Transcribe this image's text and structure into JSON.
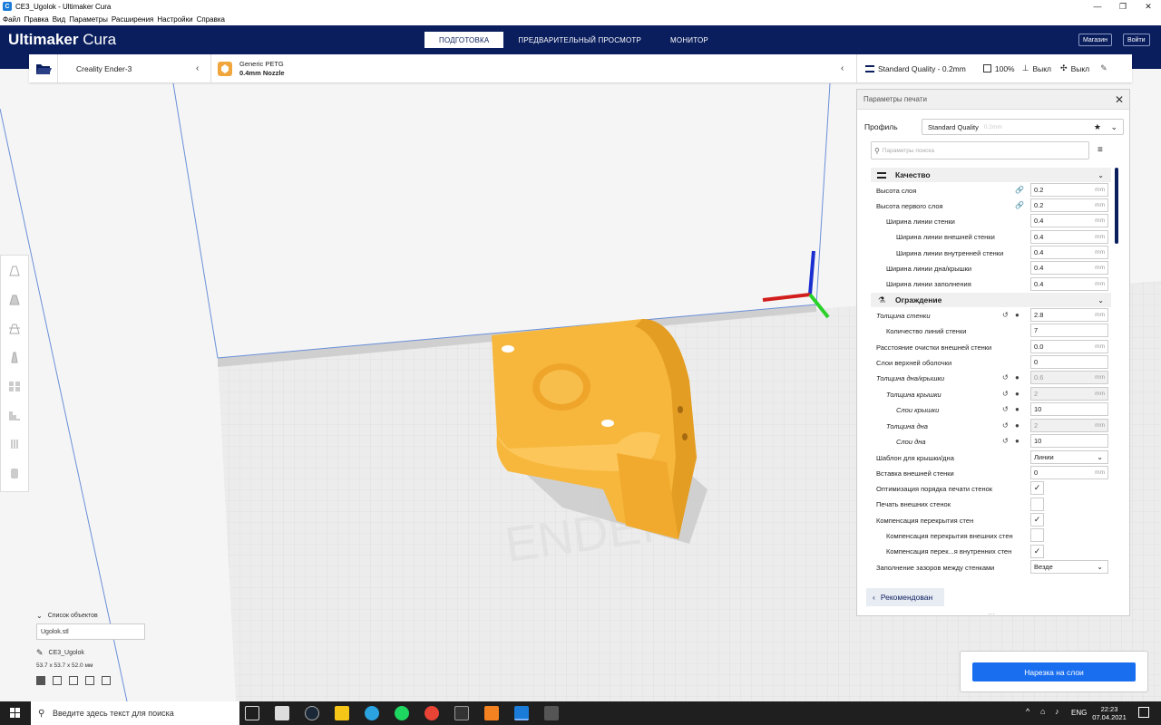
{
  "window": {
    "title": "CE3_Ugolok - Ultimaker Cura"
  },
  "menu": [
    "Файл",
    "Правка",
    "Вид",
    "Параметры",
    "Расширения",
    "Настройки",
    "Справка"
  ],
  "header": {
    "logo_bold": "Ultimaker",
    "logo_light": " Cura",
    "tabs": [
      "ПОДГОТОВКА",
      "ПРЕДВАРИТЕЛЬНЫЙ ПРОСМОТР",
      "МОНИТОР"
    ],
    "marketplace": "Магазин",
    "login": "Войти"
  },
  "stagebar": {
    "printer": "Creality Ender-3",
    "material_name": "Generic PETG",
    "nozzle": "0.4mm Nozzle",
    "quality": "Standard Quality - 0.2mm",
    "infill": "100%",
    "support": "Выкл",
    "adhesion": "Выкл"
  },
  "panel": {
    "title": "Параметры печати",
    "profile_label": "Профиль",
    "profile_value": "Standard Quality",
    "profile_hint": "0.2mm",
    "search_placeholder": "Параметры поиска",
    "categories": {
      "quality": "Качество",
      "walls": "Ограждение"
    },
    "rows": {
      "layer_height": {
        "label": "Высота слоя",
        "value": "0.2",
        "unit": "mm"
      },
      "initial_layer_height": {
        "label": "Высота первого слоя",
        "value": "0.2",
        "unit": "mm"
      },
      "wall_line_width": {
        "label": "Ширина линии стенки",
        "value": "0.4",
        "unit": "mm"
      },
      "outer_wall_line_width": {
        "label": "Ширина линии внешней стенки",
        "value": "0.4",
        "unit": "mm"
      },
      "inner_wall_line_width": {
        "label": "Ширина линии внутренней стенки",
        "value": "0.4",
        "unit": "mm"
      },
      "topbottom_line_width": {
        "label": "Ширина линии дна/крышки",
        "value": "0.4",
        "unit": "mm"
      },
      "infill_line_width": {
        "label": "Ширина линии заполнения",
        "value": "0.4",
        "unit": "mm"
      },
      "wall_thickness": {
        "label": "Толщина стенки",
        "value": "2.8",
        "unit": "mm"
      },
      "wall_line_count": {
        "label": "Количество линий стенки",
        "value": "7"
      },
      "outer_wall_wipe": {
        "label": "Расстояние очистки внешней стенки",
        "value": "0.0",
        "unit": "mm"
      },
      "top_skin_layers": {
        "label": "Слои верхней оболочки",
        "value": "0"
      },
      "topbottom_thickness": {
        "label": "Толщина дна/крышки",
        "value": "0.6",
        "unit": "mm"
      },
      "top_thickness": {
        "label": "Толщина крышки",
        "value": "2",
        "unit": "mm"
      },
      "top_layers": {
        "label": "Слои крышки",
        "value": "10"
      },
      "bottom_thickness": {
        "label": "Толщина дна",
        "value": "2",
        "unit": "mm"
      },
      "bottom_layers": {
        "label": "Слои дна",
        "value": "10"
      },
      "topbottom_pattern": {
        "label": "Шаблон для крышки/дна",
        "value": "Линии"
      },
      "outer_wall_inset": {
        "label": "Вставка внешней стенки",
        "value": "0",
        "unit": "mm"
      },
      "optimize_wall_order": {
        "label": "Оптимизация порядка печати стенок"
      },
      "outer_before_inner": {
        "label": "Печать внешних стенок"
      },
      "wall_overlap_comp": {
        "label": "Компенсация перекрытия стен"
      },
      "outer_wall_overlap": {
        "label": "Компенсация перекрытия внешних стен"
      },
      "inner_wall_overlap": {
        "label": "Компенсация перек...я внутренних стен"
      },
      "fill_gaps": {
        "label": "Заполнение зазоров между стенками",
        "value": "Везде"
      }
    },
    "recommended": "Рекомендован"
  },
  "objects": {
    "header": "Список объектов",
    "file": "Ugolok.stl",
    "name": "CE3_Ugolok",
    "dims": "53.7 x 53.7 x 52.0 мм"
  },
  "slice_button": "Нарезка на слои",
  "taskbar": {
    "search_placeholder": "Введите здесь текст для поиска",
    "lang": "ENG",
    "time": "22:23",
    "date": "07.04.2021"
  }
}
